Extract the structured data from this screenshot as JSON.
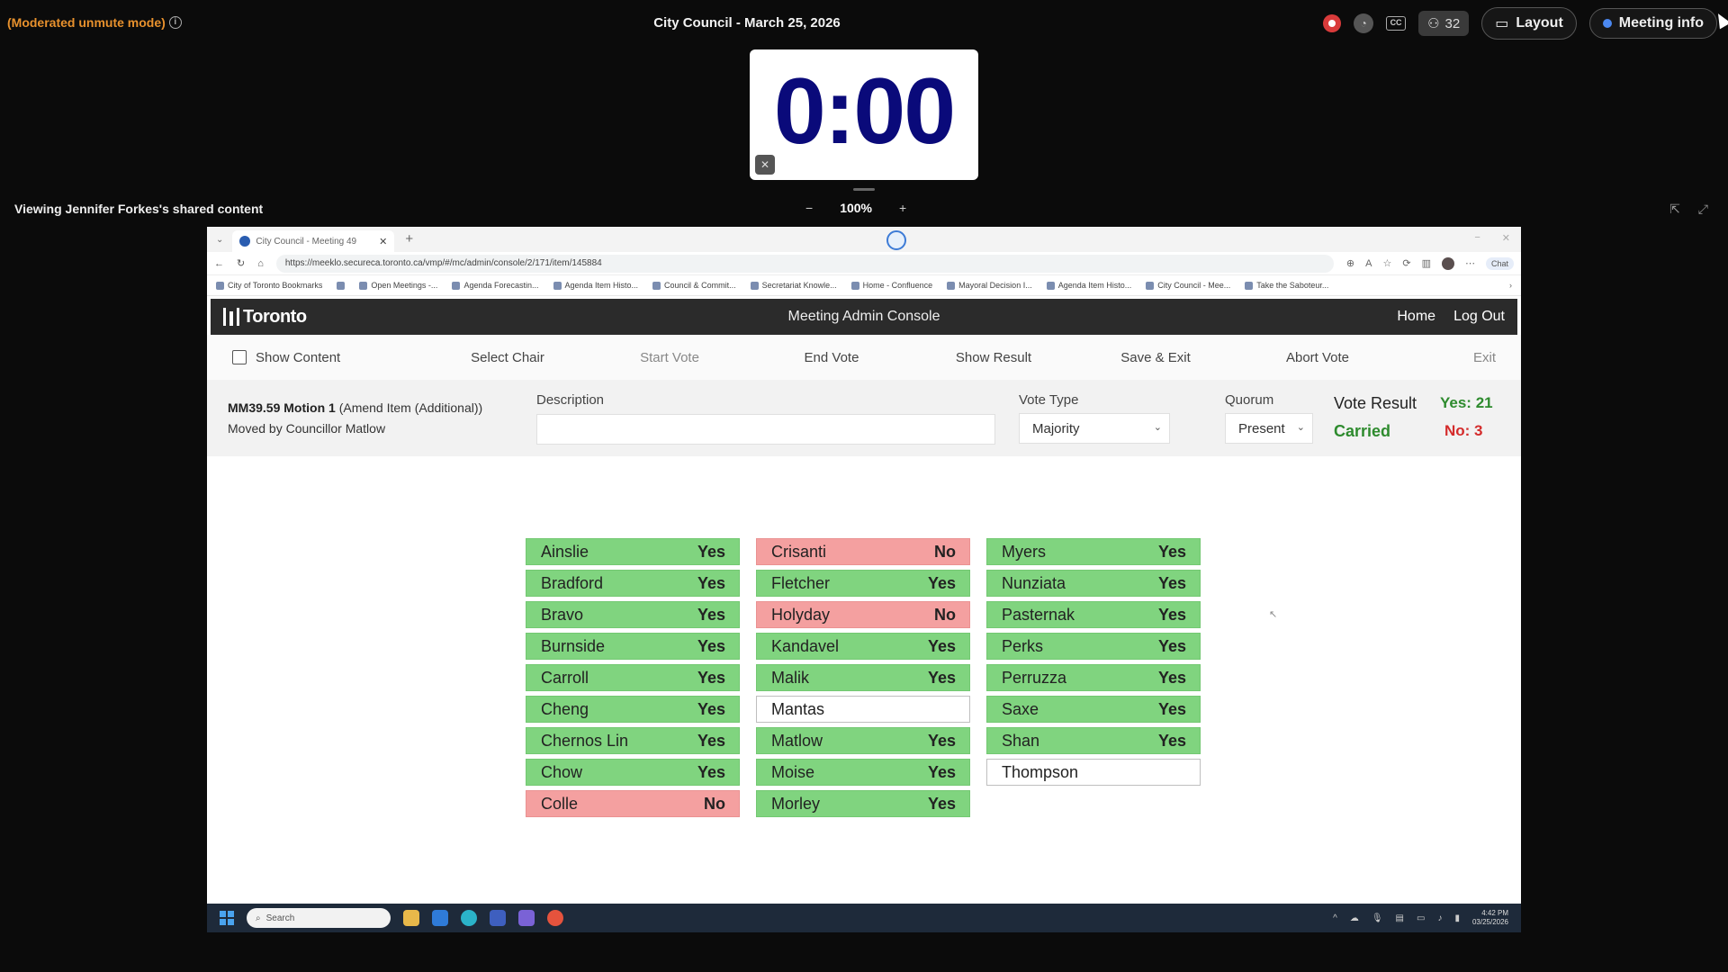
{
  "teams": {
    "moderated_mode": "(Moderated unmute mode)",
    "meeting_title": "City Council - March 25, 2026",
    "participant_count": "32",
    "layout_label": "Layout",
    "meeting_info_label": "Meeting info",
    "viewing_label": "Viewing Jennifer Forkes's shared content",
    "zoom_level": "100%",
    "zoom_out": "−",
    "zoom_in": "+"
  },
  "timer": {
    "value": "0:00"
  },
  "browser": {
    "tab_title": "City Council - Meeting 49",
    "url": "https://meeklo.secureca.toronto.ca/vmp/#/mc/admin/console/2/171/item/145884",
    "bookmarks": [
      "City of Toronto Bookmarks",
      "Open Meetings -...",
      "Agenda Forecastin...",
      "Agenda Item Histo...",
      "Council & Commit...",
      "Secretariat Knowle...",
      "Home - Confluence",
      "Mayoral Decision I...",
      "Agenda Item Histo...",
      "City Council - Mee...",
      "Take the Saboteur..."
    ],
    "chat_label": "Chat"
  },
  "console": {
    "logo_text": "Toronto",
    "title": "Meeting Admin Console",
    "home_link": "Home",
    "logout_link": "Log Out",
    "actions": {
      "show_content": "Show Content",
      "select_chair": "Select Chair",
      "start_vote": "Start Vote",
      "end_vote": "End Vote",
      "show_result": "Show Result",
      "save_exit": "Save & Exit",
      "abort_vote": "Abort Vote",
      "exit": "Exit"
    },
    "motion": {
      "id": "MM39.59 Motion 1",
      "type": "(Amend Item (Additional))",
      "mover": "Moved by Councillor Matlow"
    },
    "description_label": "Description",
    "description_value": "",
    "vote_type_label": "Vote Type",
    "vote_type_value": "Majority",
    "quorum_label": "Quorum",
    "quorum_value": "Present",
    "vote_result_label": "Vote Result",
    "vote_result_status": "Carried",
    "yes_count": "Yes: 21",
    "no_count": "No: 3"
  },
  "votes": [
    [
      {
        "name": "Ainslie",
        "vote": "Yes"
      },
      {
        "name": "Bradford",
        "vote": "Yes"
      },
      {
        "name": "Bravo",
        "vote": "Yes"
      },
      {
        "name": "Burnside",
        "vote": "Yes"
      },
      {
        "name": "Carroll",
        "vote": "Yes"
      },
      {
        "name": "Cheng",
        "vote": "Yes"
      },
      {
        "name": "Chernos Lin",
        "vote": "Yes"
      },
      {
        "name": "Chow",
        "vote": "Yes"
      },
      {
        "name": "Colle",
        "vote": "No"
      }
    ],
    [
      {
        "name": "Crisanti",
        "vote": "No"
      },
      {
        "name": "Fletcher",
        "vote": "Yes"
      },
      {
        "name": "Holyday",
        "vote": "No"
      },
      {
        "name": "Kandavel",
        "vote": "Yes"
      },
      {
        "name": "Malik",
        "vote": "Yes"
      },
      {
        "name": "Mantas",
        "vote": ""
      },
      {
        "name": "Matlow",
        "vote": "Yes"
      },
      {
        "name": "Moise",
        "vote": "Yes"
      },
      {
        "name": "Morley",
        "vote": "Yes"
      }
    ],
    [
      {
        "name": "Myers",
        "vote": "Yes"
      },
      {
        "name": "Nunziata",
        "vote": "Yes"
      },
      {
        "name": "Pasternak",
        "vote": "Yes"
      },
      {
        "name": "Perks",
        "vote": "Yes"
      },
      {
        "name": "Perruzza",
        "vote": "Yes"
      },
      {
        "name": "Saxe",
        "vote": "Yes"
      },
      {
        "name": "Shan",
        "vote": "Yes"
      },
      {
        "name": "Thompson",
        "vote": ""
      }
    ]
  ],
  "taskbar": {
    "search_placeholder": "Search",
    "clock_time": "4:42 PM",
    "clock_date": "03/25/2026"
  },
  "colors": {
    "yes": "#80d47f",
    "no": "#f4a0a0",
    "carried": "#2e8b2e",
    "no_text": "#d42b2b",
    "moderated": "#e8912d"
  }
}
